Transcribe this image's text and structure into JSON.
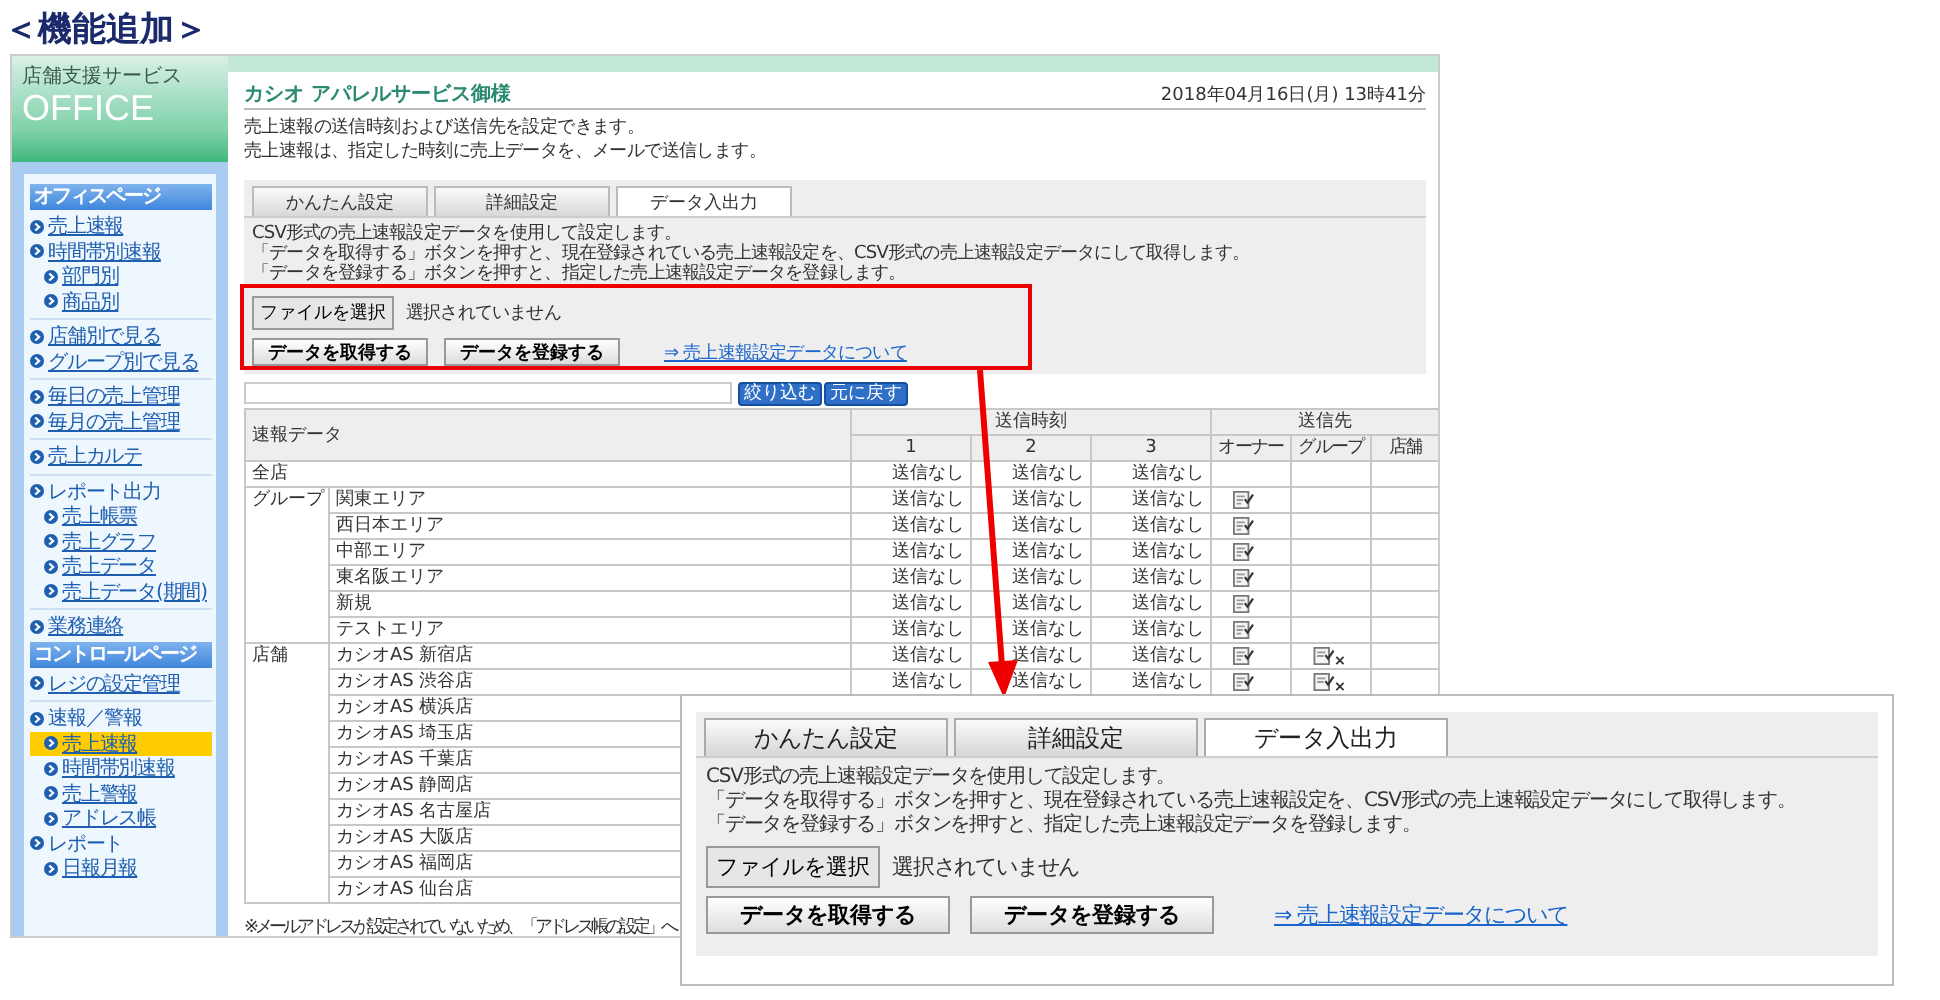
{
  "heading": "＜機能追加＞",
  "sidebar": {
    "brand_top": "店舗支援サービス",
    "brand": "OFFICE",
    "entries": [
      {
        "kind": "header",
        "label": "オフィスページ"
      },
      {
        "kind": "link",
        "label": "売上速報"
      },
      {
        "kind": "link",
        "label": "時間帯別速報",
        "children": [
          {
            "label": "部門別",
            "selected": false
          },
          {
            "label": "商品別",
            "selected": false
          }
        ]
      },
      {
        "kind": "divider"
      },
      {
        "kind": "link",
        "label": "店舗別で見る"
      },
      {
        "kind": "link",
        "label": "グループ別で見る"
      },
      {
        "kind": "divider"
      },
      {
        "kind": "link",
        "label": "毎日の売上管理"
      },
      {
        "kind": "link",
        "label": "毎月の売上管理"
      },
      {
        "kind": "divider"
      },
      {
        "kind": "link",
        "label": "売上カルテ"
      },
      {
        "kind": "divider"
      },
      {
        "kind": "label",
        "label": "レポート出力",
        "children": [
          {
            "label": "売上帳票",
            "selected": false
          },
          {
            "label": "売上グラフ",
            "selected": false
          },
          {
            "label": "売上データ",
            "selected": false
          },
          {
            "label": "売上データ(期間)",
            "selected": false
          }
        ]
      },
      {
        "kind": "divider"
      },
      {
        "kind": "link",
        "label": "業務連絡"
      },
      {
        "kind": "header",
        "label": "コントロールページ"
      },
      {
        "kind": "link",
        "label": "レジの設定管理"
      },
      {
        "kind": "divider"
      },
      {
        "kind": "label",
        "label": "速報／警報",
        "children": [
          {
            "label": "売上速報",
            "selected": true
          },
          {
            "label": "時間帯別速報",
            "selected": false
          },
          {
            "label": "売上警報",
            "selected": false
          },
          {
            "label": "アドレス帳",
            "selected": false
          }
        ]
      },
      {
        "kind": "label",
        "label": "レポート",
        "children": [
          {
            "label": "日報月報",
            "selected": false
          }
        ]
      }
    ]
  },
  "header": {
    "title": "カシオ アパレルサービス御様",
    "datetime": "2018年04月16日(月) 13時41分"
  },
  "intro": [
    "売上速報の送信時刻および送信先を設定できます。",
    "売上速報は、指定した時刻に売上データを、メールで送信します。"
  ],
  "tabs": [
    {
      "label": "かんたん設定",
      "selected": false
    },
    {
      "label": "詳細設定",
      "selected": false
    },
    {
      "label": "データ入出力",
      "selected": true
    }
  ],
  "panel": {
    "lines": [
      "CSV形式の売上速報設定データを使用して設定します。",
      "「データを取得する」ボタンを押すと、現在登録されている売上速報設定を、CSV形式の売上速報設定データにして取得します。",
      "「データを登録する」ボタンを押すと、指定した売上速報設定データを登録します。"
    ],
    "file_button": "ファイルを選択",
    "file_status": "選択されていません",
    "buttons": [
      "データを取得する",
      "データを登録する"
    ],
    "link": "⇒ 売上速報設定データについて"
  },
  "filter": {
    "buttons": [
      "絞り込む",
      "元に戻す"
    ]
  },
  "table": {
    "head": "速報データ",
    "time_head": "送信時刻",
    "time_columns": [
      "1",
      "2",
      "3"
    ],
    "dest_head": "送信先",
    "dest_columns": [
      "オーナー",
      "グループ",
      "店舗"
    ],
    "groups": [
      {
        "label": "全店",
        "times": [
          "送信なし",
          "送信なし",
          "送信なし"
        ]
      },
      {
        "label": "グループ",
        "rows": [
          {
            "name": "関東エリア",
            "times": [
              "送信なし",
              "送信なし",
              "送信なし"
            ],
            "owner": true,
            "group": false
          },
          {
            "name": "西日本エリア",
            "times": [
              "送信なし",
              "送信なし",
              "送信なし"
            ],
            "owner": true,
            "group": false
          },
          {
            "name": "中部エリア",
            "times": [
              "送信なし",
              "送信なし",
              "送信なし"
            ],
            "owner": true,
            "group": false
          },
          {
            "name": "東名阪エリア",
            "times": [
              "送信なし",
              "送信なし",
              "送信なし"
            ],
            "owner": true,
            "group": false
          },
          {
            "name": "新規",
            "times": [
              "送信なし",
              "送信なし",
              "送信なし"
            ],
            "owner": true,
            "group": false
          },
          {
            "name": "テストエリア",
            "times": [
              "送信なし",
              "送信なし",
              "送信なし"
            ],
            "owner": true,
            "group": false
          }
        ]
      },
      {
        "label": "店舗",
        "rows": [
          {
            "name": "カシオAS 新宿店",
            "times": [
              "送信なし",
              "送信なし",
              "送信なし"
            ],
            "owner": true,
            "group": true
          },
          {
            "name": "カシオAS 渋谷店",
            "times": [
              "送信なし",
              "送信なし",
              "送信なし"
            ],
            "owner": true,
            "group": true
          },
          {
            "name": "カシオAS 横浜店"
          },
          {
            "name": "カシオAS 埼玉店"
          },
          {
            "name": "カシオAS 千葉店"
          },
          {
            "name": "カシオAS 静岡店"
          },
          {
            "name": "カシオAS 名古屋店"
          },
          {
            "name": "カシオAS 大阪店"
          },
          {
            "name": "カシオAS 福岡店"
          },
          {
            "name": "カシオAS 仙台店"
          }
        ]
      }
    ]
  },
  "footnote": "※メールアドレスが設定されていないため、「アドレス帳の設定」へ",
  "zoom": {
    "tabs": [
      {
        "label": "かんたん設定",
        "selected": false
      },
      {
        "label": "詳細設定",
        "selected": false
      },
      {
        "label": "データ入出力",
        "selected": true
      }
    ],
    "lines": [
      "CSV形式の売上速報設定データを使用して設定します。",
      "「データを取得する」ボタンを押すと、現在登録されている売上速報設定を、CSV形式の売上速報設定データにして取得します。",
      "「データを登録する」ボタンを押すと、指定した売上速報設定データを登録します。"
    ],
    "file_button": "ファイルを選択",
    "file_status": "選択されていません",
    "buttons": [
      "データを取得する",
      "データを登録する"
    ],
    "link": "⇒ 売上速報設定データについて"
  }
}
